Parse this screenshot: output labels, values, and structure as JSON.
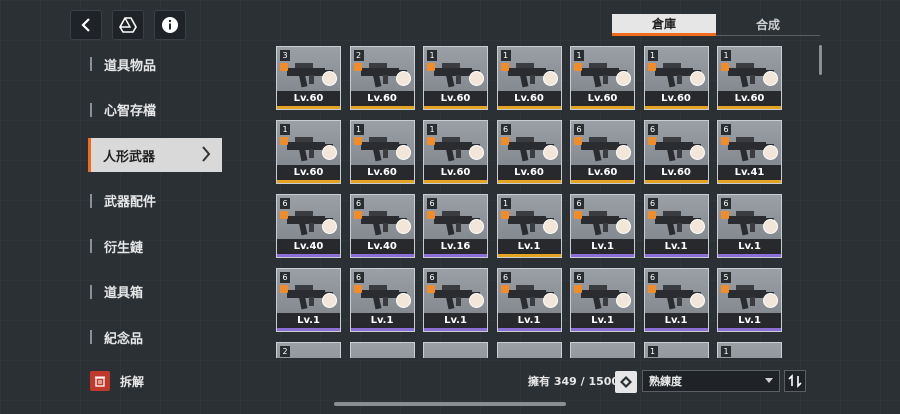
{
  "nav": {
    "items": [
      {
        "label": "道具物品"
      },
      {
        "label": "心智存檔"
      },
      {
        "label": "人形武器",
        "active": true
      },
      {
        "label": "武器配件"
      },
      {
        "label": "衍生鏈"
      },
      {
        "label": "道具箱"
      },
      {
        "label": "紀念品"
      }
    ],
    "dismantle_label": "拆解"
  },
  "tabs": {
    "warehouse": "倉庫",
    "synthesis": "合成"
  },
  "footer": {
    "owned_label": "擁有 349 / 1500",
    "sort_value": "熟練度"
  },
  "colors": {
    "accent": "#f26a1b",
    "rarity_gold": "#e3a323",
    "rarity_purple": "#8b6fd6",
    "card_bg": "#8a9096",
    "danger": "#c0392b"
  },
  "icons": {
    "back": "chevron-left-icon",
    "drive": "triangle-drive-icon",
    "info": "info-icon",
    "trash": "trash-icon",
    "filter": "filter-diamond-icon",
    "sort_order": "sort-order-icon"
  },
  "weapons": [
    {
      "badge": "3",
      "level": "Lv.60",
      "rarity": "gold"
    },
    {
      "badge": "2",
      "level": "Lv.60",
      "rarity": "gold"
    },
    {
      "badge": "1",
      "level": "Lv.60",
      "rarity": "gold"
    },
    {
      "badge": "1",
      "level": "Lv.60",
      "rarity": "gold"
    },
    {
      "badge": "1",
      "level": "Lv.60",
      "rarity": "gold"
    },
    {
      "badge": "1",
      "level": "Lv.60",
      "rarity": "gold"
    },
    {
      "badge": "1",
      "level": "Lv.60",
      "rarity": "gold"
    },
    {
      "badge": "1",
      "level": "Lv.60",
      "rarity": "gold"
    },
    {
      "badge": "1",
      "level": "Lv.60",
      "rarity": "gold"
    },
    {
      "badge": "1",
      "level": "Lv.60",
      "rarity": "gold"
    },
    {
      "badge": "6",
      "level": "Lv.60",
      "rarity": "gold"
    },
    {
      "badge": "6",
      "level": "Lv.60",
      "rarity": "gold"
    },
    {
      "badge": "6",
      "level": "Lv.60",
      "rarity": "gold"
    },
    {
      "badge": "6",
      "level": "Lv.41",
      "rarity": "gold"
    },
    {
      "badge": "6",
      "level": "Lv.40",
      "rarity": "purple"
    },
    {
      "badge": "6",
      "level": "Lv.40",
      "rarity": "purple"
    },
    {
      "badge": "6",
      "level": "Lv.16",
      "rarity": "purple"
    },
    {
      "badge": "1",
      "level": "Lv.1",
      "rarity": "gold"
    },
    {
      "badge": "6",
      "level": "Lv.1",
      "rarity": "purple"
    },
    {
      "badge": "6",
      "level": "Lv.1",
      "rarity": "purple"
    },
    {
      "badge": "6",
      "level": "Lv.1",
      "rarity": "purple"
    },
    {
      "badge": "6",
      "level": "Lv.1",
      "rarity": "purple"
    },
    {
      "badge": "6",
      "level": "Lv.1",
      "rarity": "purple"
    },
    {
      "badge": "6",
      "level": "Lv.1",
      "rarity": "purple"
    },
    {
      "badge": "6",
      "level": "Lv.1",
      "rarity": "purple"
    },
    {
      "badge": "6",
      "level": "Lv.1",
      "rarity": "purple"
    },
    {
      "badge": "6",
      "level": "Lv.1",
      "rarity": "purple"
    },
    {
      "badge": "5",
      "level": "Lv.1",
      "rarity": "purple"
    },
    {
      "badge": "2",
      "level": "",
      "rarity": "purple"
    },
    {
      "badge": "",
      "level": "",
      "rarity": "purple"
    },
    {
      "badge": "",
      "level": "",
      "rarity": "purple"
    },
    {
      "badge": "",
      "level": "",
      "rarity": "purple"
    },
    {
      "badge": "",
      "level": "",
      "rarity": "purple"
    },
    {
      "badge": "1",
      "level": "",
      "rarity": "purple"
    },
    {
      "badge": "1",
      "level": "",
      "rarity": "purple"
    }
  ]
}
